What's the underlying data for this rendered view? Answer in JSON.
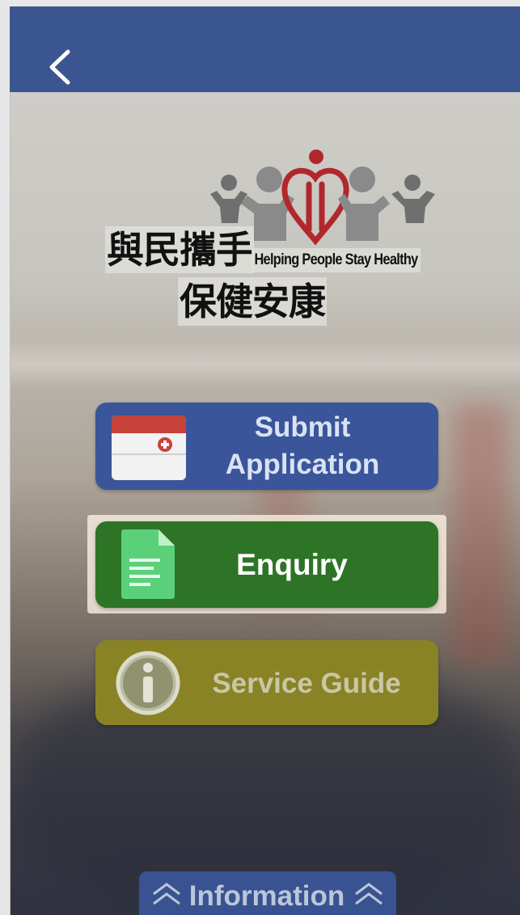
{
  "header": {
    "back_icon": "chevron-left-icon",
    "bar_color": "#3b5591"
  },
  "logo": {
    "slogan_cn_line1": "與民攜手",
    "slogan_en": "Helping People Stay Healthy",
    "slogan_cn_line2": "保健安康",
    "mark_color": "#b0282c",
    "figure_color": "#8a8a8a"
  },
  "menu": {
    "submit": {
      "label_line1": "Submit",
      "label_line2": "Application",
      "icon": "medical-calendar-icon",
      "color": "#3a5599"
    },
    "enquiry": {
      "label": "Enquiry",
      "icon": "document-icon",
      "color": "#2e7426"
    },
    "guide": {
      "label": "Service Guide",
      "icon": "info-icon",
      "color": "#8a8325"
    }
  },
  "info_tab": {
    "label": "Information",
    "icon": "double-chevron-up-icon"
  }
}
